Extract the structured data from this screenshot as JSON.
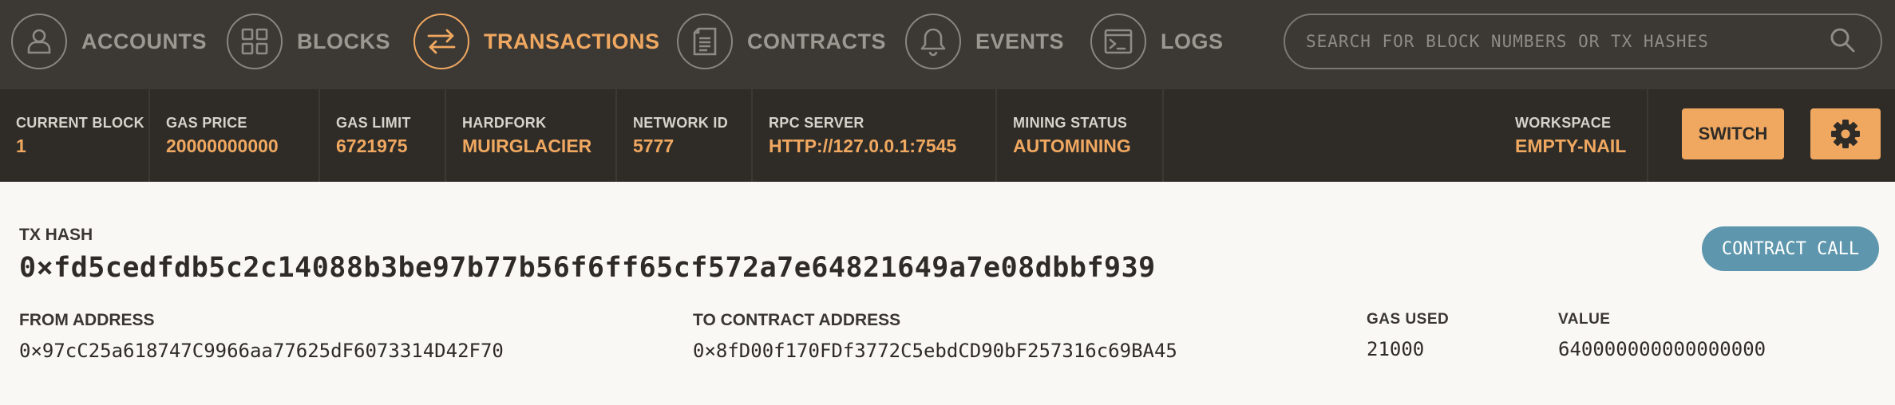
{
  "nav": {
    "items": [
      {
        "label": "ACCOUNTS",
        "icon": "account-icon"
      },
      {
        "label": "BLOCKS",
        "icon": "blocks-icon"
      },
      {
        "label": "TRANSACTIONS",
        "icon": "transactions-icon",
        "active": true
      },
      {
        "label": "CONTRACTS",
        "icon": "contracts-icon"
      },
      {
        "label": "EVENTS",
        "icon": "bell-icon"
      },
      {
        "label": "LOGS",
        "icon": "terminal-icon"
      }
    ],
    "search_placeholder": "SEARCH FOR BLOCK NUMBERS OR TX HASHES"
  },
  "status": {
    "current_block": {
      "label": "CURRENT BLOCK",
      "value": "1"
    },
    "gas_price": {
      "label": "GAS PRICE",
      "value": "20000000000"
    },
    "gas_limit": {
      "label": "GAS LIMIT",
      "value": "6721975"
    },
    "hardfork": {
      "label": "HARDFORK",
      "value": "MUIRGLACIER"
    },
    "network_id": {
      "label": "NETWORK ID",
      "value": "5777"
    },
    "rpc_server": {
      "label": "RPC SERVER",
      "value": "HTTP://127.0.0.1:7545"
    },
    "mining_status": {
      "label": "MINING STATUS",
      "value": "AUTOMINING"
    },
    "workspace": {
      "label": "WORKSPACE",
      "value": "EMPTY-NAIL"
    },
    "switch_label": "SWITCH"
  },
  "tx": {
    "hash_label": "TX HASH",
    "hash": "0×fd5cedfdb5c2c14088b3be97b77b56f6ff65cf572a7e64821649a7e08dbbf939",
    "type_badge": "CONTRACT CALL",
    "from_label": "FROM ADDRESS",
    "from": "0×97cC25a618747C9966aa77625dF6073314D42F70",
    "to_label": "TO CONTRACT ADDRESS",
    "to": "0×8fD00f170FDf3772C5ebdCD90bF257316c69BA45",
    "gas_used_label": "GAS USED",
    "gas_used": "21000",
    "value_label": "VALUE",
    "value": "640000000000000000"
  },
  "colors": {
    "accent": "#f0a860",
    "nav_bg": "#3c3935",
    "status_bg": "#2f2c28",
    "badge": "#5e97ad",
    "page_bg": "#f9f8f5"
  }
}
